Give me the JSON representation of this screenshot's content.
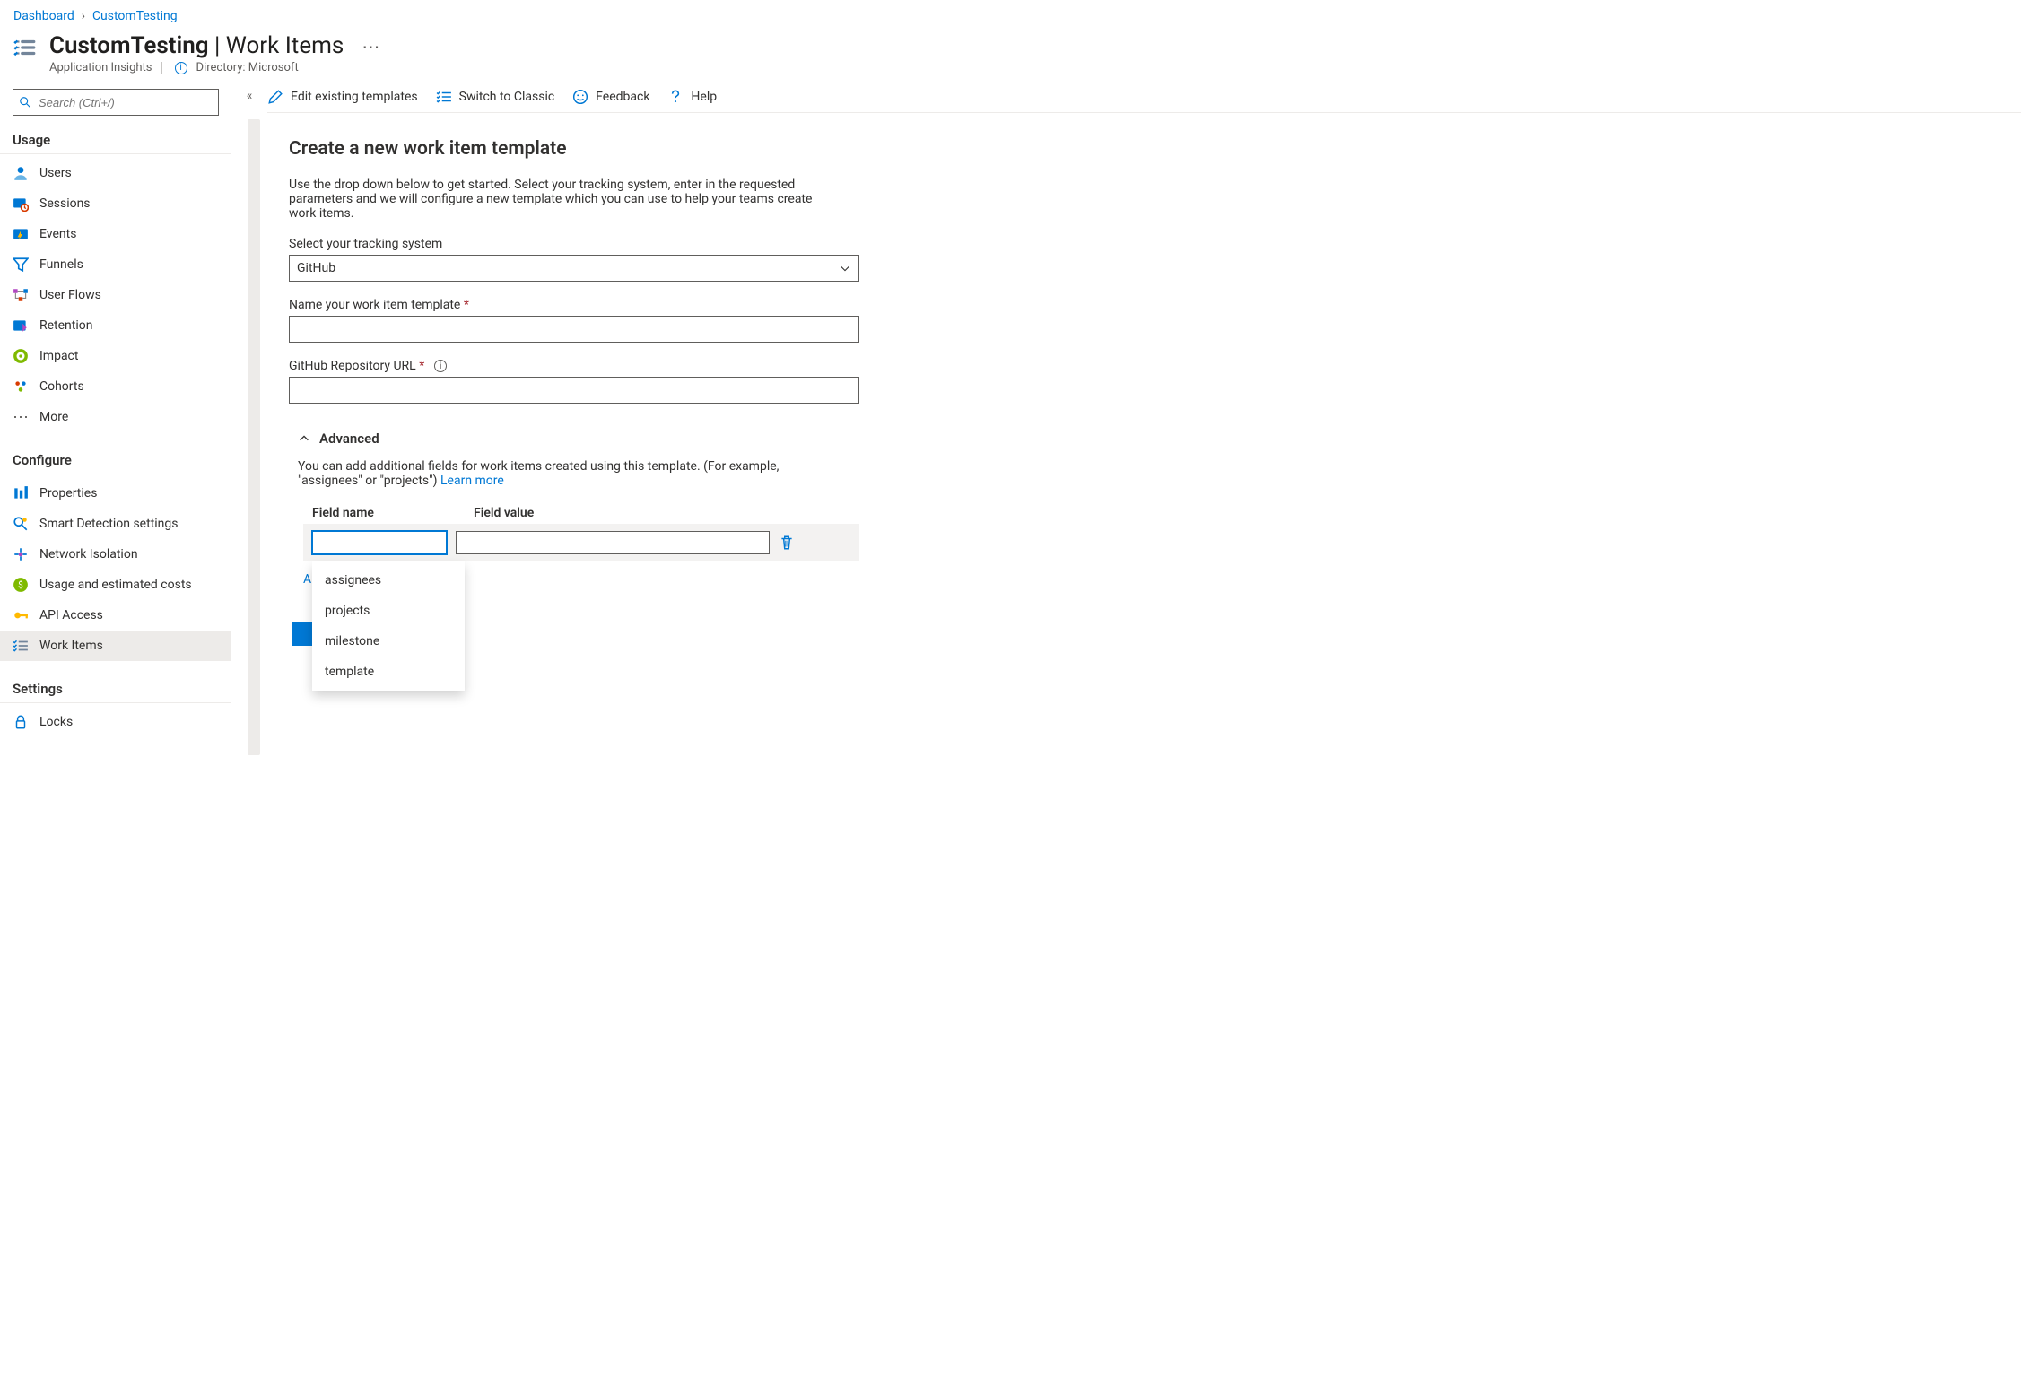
{
  "breadcrumb": {
    "root": "Dashboard",
    "current": "CustomTesting"
  },
  "header": {
    "resource_name": "CustomTesting",
    "section": "Work Items",
    "subtitle": "Application Insights",
    "directory_label": "Directory: Microsoft"
  },
  "search": {
    "placeholder": "Search (Ctrl+/)"
  },
  "sidebar": {
    "section_usage": "Usage",
    "section_configure": "Configure",
    "section_settings": "Settings",
    "usage_items": [
      "Users",
      "Sessions",
      "Events",
      "Funnels",
      "User Flows",
      "Retention",
      "Impact",
      "Cohorts",
      "More"
    ],
    "configure_items": [
      "Properties",
      "Smart Detection settings",
      "Network Isolation",
      "Usage and estimated costs",
      "API Access",
      "Work Items"
    ],
    "settings_items": [
      "Locks"
    ]
  },
  "cmdbar": {
    "edit": "Edit existing templates",
    "classic": "Switch to Classic",
    "feedback": "Feedback",
    "help": "Help"
  },
  "form": {
    "title": "Create a new work item template",
    "intro": "Use the drop down below to get started. Select your tracking system, enter in the requested parameters and we will configure a new template which you can use to help your teams create work items.",
    "tracking_label": "Select your tracking system",
    "tracking_value": "GitHub",
    "name_label": "Name your work item template",
    "repo_label": "GitHub Repository URL"
  },
  "advanced": {
    "heading": "Advanced",
    "desc": "You can add additional fields for work items created using this template. (For example, \"assignees\" or \"projects\")",
    "learn_more": "Learn more",
    "col_name": "Field name",
    "col_value": "Field value",
    "add_partial": "A",
    "options": [
      "assignees",
      "projects",
      "milestone",
      "template"
    ]
  }
}
